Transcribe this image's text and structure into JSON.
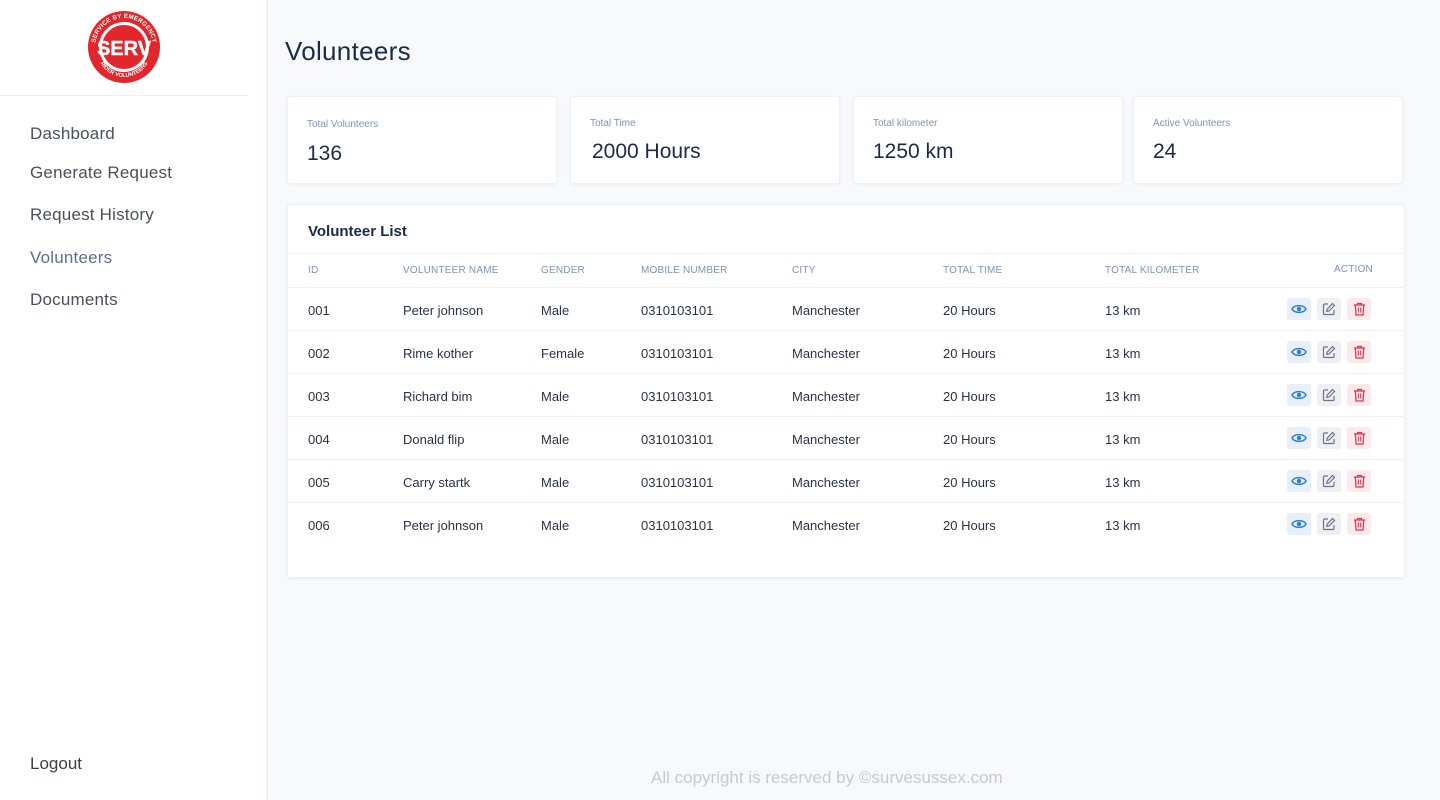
{
  "brand": {
    "logo_text": "SERV",
    "logo_ring_top": "SERVICE BY EMERGENCY",
    "logo_ring_bottom": "RIDER VOLUNTEERS",
    "color": "#e3262b"
  },
  "sidebar": {
    "items": [
      {
        "label": "Dashboard"
      },
      {
        "label": "Generate Request"
      },
      {
        "label": "Request History"
      },
      {
        "label": "Volunteers"
      },
      {
        "label": "Documents"
      }
    ],
    "active": "Volunteers",
    "logout": "Logout"
  },
  "page": {
    "title": "Volunteers"
  },
  "stats": [
    {
      "label": "Total Volunteers",
      "value": "136"
    },
    {
      "label": "Total Time",
      "value": "2000 Hours"
    },
    {
      "label": "Total kilometer",
      "value": "1250 km"
    },
    {
      "label": "Active Volunteers",
      "value": "24"
    }
  ],
  "volunteer_list": {
    "title": "Volunteer List",
    "columns": [
      "ID",
      "Volunteer Name",
      "Gender",
      "Mobile Number",
      "City",
      "Total Time",
      "Total Kilometer",
      "Action"
    ],
    "rows": [
      {
        "id": "001",
        "name": "Peter johnson",
        "gender": "Male",
        "mobile": "0310103101",
        "city": "Manchester",
        "time": "20 Hours",
        "km": "13 km"
      },
      {
        "id": "002",
        "name": "Rime kother",
        "gender": "Female",
        "mobile": "0310103101",
        "city": "Manchester",
        "time": "20 Hours",
        "km": "13 km"
      },
      {
        "id": "003",
        "name": "Richard bim",
        "gender": "Male",
        "mobile": "0310103101",
        "city": "Manchester",
        "time": "20 Hours",
        "km": "13 km"
      },
      {
        "id": "004",
        "name": "Donald flip",
        "gender": "Male",
        "mobile": "0310103101",
        "city": "Manchester",
        "time": "20 Hours",
        "km": "13 km"
      },
      {
        "id": "005",
        "name": "Carry startk",
        "gender": "Male",
        "mobile": "0310103101",
        "city": "Manchester",
        "time": "20 Hours",
        "km": "13 km"
      },
      {
        "id": "006",
        "name": "Peter johnson",
        "gender": "Male",
        "mobile": "0310103101",
        "city": "Manchester",
        "time": "20 Hours",
        "km": "13 km"
      }
    ],
    "actions": [
      {
        "icon": "eye-icon",
        "color": "#2f7fd1"
      },
      {
        "icon": "edit-icon",
        "color": "#6b7386"
      },
      {
        "icon": "trash-icon",
        "color": "#e0364f"
      }
    ]
  },
  "footer": {
    "text": "All copyright is reserved by ©survesussex.com"
  }
}
